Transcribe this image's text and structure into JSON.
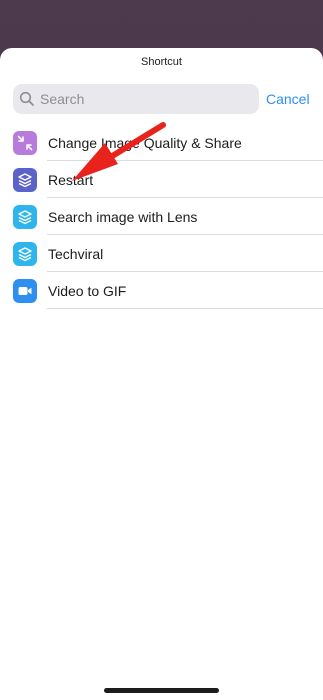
{
  "sheet": {
    "title": "Shortcut"
  },
  "search": {
    "placeholder": "Search",
    "cancel_label": "Cancel"
  },
  "items": [
    {
      "label": "Change Image Quality & Share",
      "icon": "compress-arrows-icon",
      "color": "#b77bdc"
    },
    {
      "label": "Restart",
      "icon": "shortcuts-layers-icon",
      "color": "#5b63c9"
    },
    {
      "label": "Search image with Lens",
      "icon": "shortcuts-layers-icon",
      "color": "#2eb6ec"
    },
    {
      "label": "Techviral",
      "icon": "shortcuts-layers-icon",
      "color": "#2eb6ec"
    },
    {
      "label": "Video to GIF",
      "icon": "video-camera-icon",
      "color": "#2f8ff0"
    }
  ],
  "annotation": {
    "icon": "red-arrow-icon",
    "color": "#e8231b"
  }
}
